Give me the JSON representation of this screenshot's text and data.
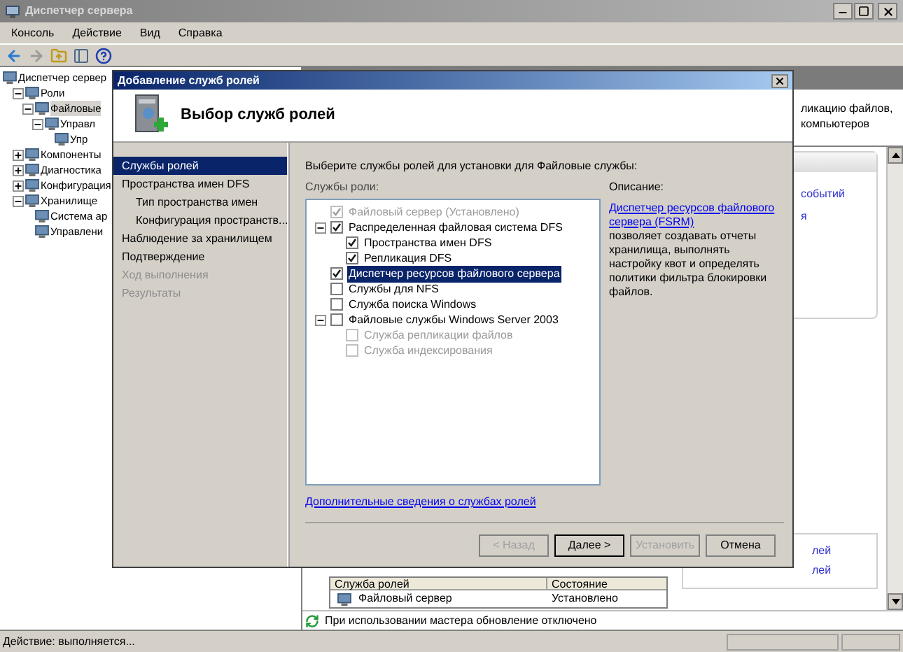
{
  "window": {
    "title": "Диспетчер сервера"
  },
  "menu": [
    "Консоль",
    "Действие",
    "Вид",
    "Справка"
  ],
  "tree": [
    {
      "label": "Диспетчер сервер",
      "selected": false,
      "children": [
        {
          "label": "Роли",
          "expanded": true,
          "selected": false,
          "children": [
            {
              "label": "Файловые",
              "expanded": true,
              "selected": true,
              "children": [
                {
                  "label": "Управл",
                  "expanded": true,
                  "selected": false,
                  "children": [
                    {
                      "label": "Упр",
                      "selected": false
                    }
                  ]
                }
              ]
            }
          ]
        },
        {
          "label": "Компоненты",
          "expanded": false,
          "selected": false
        },
        {
          "label": "Диагностика",
          "expanded": false,
          "selected": false
        },
        {
          "label": "Конфигурация",
          "expanded": false,
          "selected": false
        },
        {
          "label": "Хранилище",
          "expanded": true,
          "selected": false,
          "children": [
            {
              "label": "Система ар",
              "selected": false
            },
            {
              "label": "Управлени",
              "selected": false
            }
          ]
        }
      ]
    }
  ],
  "right_pane": {
    "summary_lines": [
      "ликацию файлов,",
      "компьютеров"
    ],
    "top_links": [
      "событий",
      "я"
    ],
    "bottom_links": [
      "лей",
      "лей"
    ],
    "table": {
      "columns": [
        "Служба ролей",
        "Состояние"
      ],
      "rows": [
        [
          "Файловый сервер",
          "Установлено"
        ]
      ]
    },
    "notice": "При использовании мастера обновление отключено"
  },
  "dialog": {
    "title": "Добавление служб ролей",
    "heading": "Выбор служб ролей",
    "nav": [
      {
        "label": "Службы ролей",
        "selected": true,
        "disabled": false
      },
      {
        "label": "Пространства имен DFS",
        "selected": false,
        "disabled": false,
        "children": [
          {
            "label": "Тип пространства имен",
            "selected": false,
            "disabled": false
          },
          {
            "label": "Конфигурация пространств...",
            "selected": false,
            "disabled": false
          }
        ]
      },
      {
        "label": "Наблюдение за хранилищем",
        "selected": false,
        "disabled": false
      },
      {
        "label": "Подтверждение",
        "selected": false,
        "disabled": false
      },
      {
        "label": "Ход выполнения",
        "selected": false,
        "disabled": true
      },
      {
        "label": "Результаты",
        "selected": false,
        "disabled": true
      }
    ],
    "instruction": "Выберите службы ролей для установки для Файловые службы:",
    "services_label": "Службы роли:",
    "services": [
      {
        "label": "Файловый сервер (Установлено)",
        "checked": true,
        "disabled": true,
        "selected": false
      },
      {
        "label": "Распределенная файловая система DFS",
        "checked": true,
        "disabled": false,
        "selected": false,
        "expanded": true,
        "children": [
          {
            "label": "Пространства имен DFS",
            "checked": true,
            "disabled": false,
            "selected": false
          },
          {
            "label": "Репликация DFS",
            "checked": true,
            "disabled": false,
            "selected": false
          }
        ]
      },
      {
        "label": "Диспетчер ресурсов файлового сервера",
        "checked": true,
        "disabled": false,
        "selected": true
      },
      {
        "label": "Службы для NFS",
        "checked": false,
        "disabled": false,
        "selected": false
      },
      {
        "label": "Служба поиска Windows",
        "checked": false,
        "disabled": false,
        "selected": false
      },
      {
        "label": "Файловые службы Windows Server 2003",
        "checked": false,
        "disabled": false,
        "selected": false,
        "expanded": true,
        "children": [
          {
            "label": "Служба репликации файлов",
            "checked": false,
            "disabled": true,
            "selected": false
          },
          {
            "label": "Служба индексирования",
            "checked": false,
            "disabled": true,
            "selected": false
          }
        ]
      }
    ],
    "description_label": "Описание:",
    "description_link": "Диспетчер ресурсов файлового сервера (FSRM)",
    "description_text": "позволяет создавать отчеты хранилища, выполнять настройку квот и определять политики фильтра блокировки файлов.",
    "more_link": "Дополнительные сведения о службах ролей",
    "buttons": [
      {
        "label": "< Назад",
        "disabled": true,
        "default": false
      },
      {
        "label": "Далее >",
        "disabled": false,
        "default": true
      },
      {
        "label": "Установить",
        "disabled": true,
        "default": false
      },
      {
        "label": "Отмена",
        "disabled": false,
        "default": false
      }
    ]
  },
  "status_bar": "Действие: выполняется..."
}
